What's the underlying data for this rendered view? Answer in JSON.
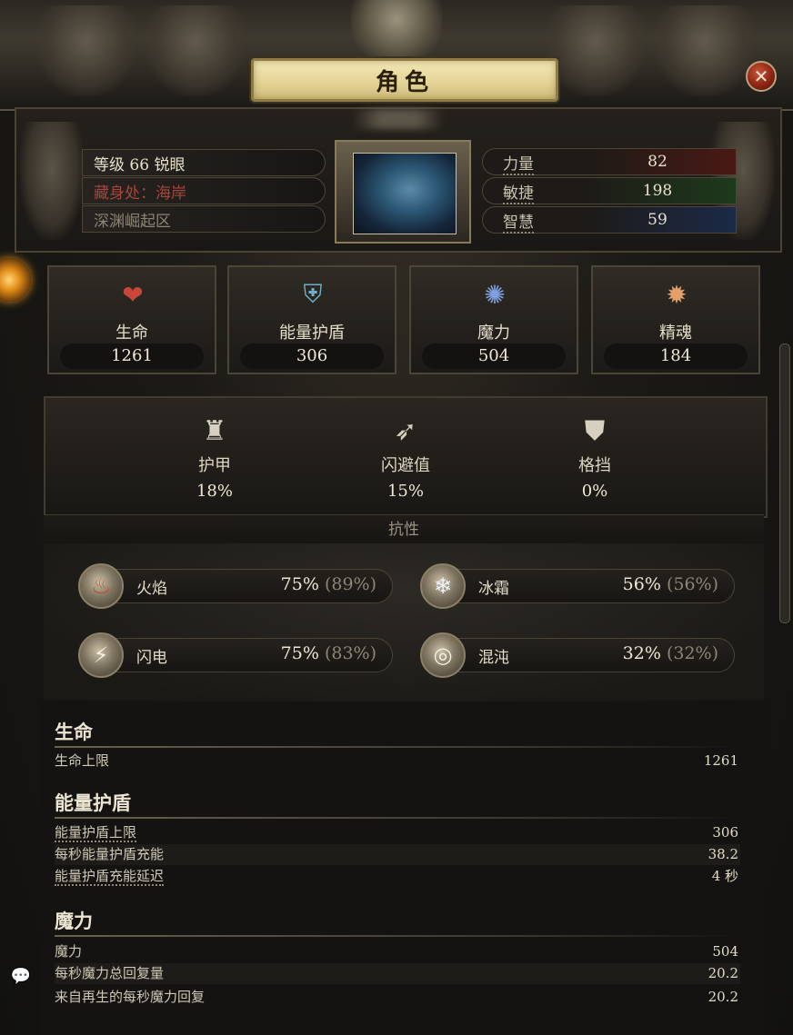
{
  "window": {
    "title": "角色",
    "close_icon": "✕"
  },
  "character": {
    "level_text": "等级 66 锐眼",
    "hideout_text": "藏身处：海岸",
    "zone_text": "深渊崛起区"
  },
  "attributes": [
    {
      "label": "力量",
      "value": "82",
      "color": "#4a1914"
    },
    {
      "label": "敏捷",
      "value": "198",
      "color": "#1d3a1c"
    },
    {
      "label": "智慧",
      "value": "59",
      "color": "#1b2a48"
    }
  ],
  "core_stats": [
    {
      "label": "生命",
      "value": "1261",
      "icon": "heart-icon",
      "glyph": "❤",
      "color": "#c8463a"
    },
    {
      "label": "能量护盾",
      "value": "306",
      "icon": "shield-crest-icon",
      "glyph": "⛨",
      "color": "#6fb0c8"
    },
    {
      "label": "魔力",
      "value": "504",
      "icon": "mana-orb-icon",
      "glyph": "✺",
      "color": "#7fa0e0"
    },
    {
      "label": "精魂",
      "value": "184",
      "icon": "spirit-orb-icon",
      "glyph": "✹",
      "color": "#e3a06a"
    }
  ],
  "defence_stats": [
    {
      "label": "护甲",
      "value": "18%",
      "icon": "armour-icon",
      "glyph": "♜"
    },
    {
      "label": "闪避值",
      "value": "15%",
      "icon": "evasion-icon",
      "glyph": "➶"
    },
    {
      "label": "格挡",
      "value": "0%",
      "icon": "block-shield-icon",
      "glyph": "⛊"
    }
  ],
  "resistances": {
    "heading": "抗性",
    "items": [
      {
        "label": "火焰",
        "value": "75%",
        "max": "(89%)",
        "icon": "fire-icon",
        "glyph": "♨"
      },
      {
        "label": "冰霜",
        "value": "56%",
        "max": "(56%)",
        "icon": "snowflake-icon",
        "glyph": "❄"
      },
      {
        "label": "闪电",
        "value": "75%",
        "max": "(83%)",
        "icon": "lightning-icon",
        "glyph": "⚡"
      },
      {
        "label": "混沌",
        "value": "32%",
        "max": "(32%)",
        "icon": "chaos-swirl-icon",
        "glyph": "◎"
      }
    ]
  },
  "details": {
    "life": {
      "title": "生命",
      "rows": [
        {
          "label": "生命上限",
          "value": "1261"
        }
      ]
    },
    "energy_shield": {
      "title": "能量护盾",
      "rows": [
        {
          "label": "能量护盾上限",
          "value": "306"
        },
        {
          "label": "每秒能量护盾充能",
          "value": "38.2"
        },
        {
          "label": "能量护盾充能延迟",
          "value": "4 秒"
        }
      ]
    },
    "mana": {
      "title": "魔力",
      "rows": [
        {
          "label": "魔力",
          "value": "504"
        },
        {
          "label": "每秒魔力总回复量",
          "value": "20.2"
        },
        {
          "label": "来自再生的每秒魔力回复",
          "value": "20.2"
        }
      ]
    }
  },
  "misc": {
    "chat_icon": "💬"
  }
}
